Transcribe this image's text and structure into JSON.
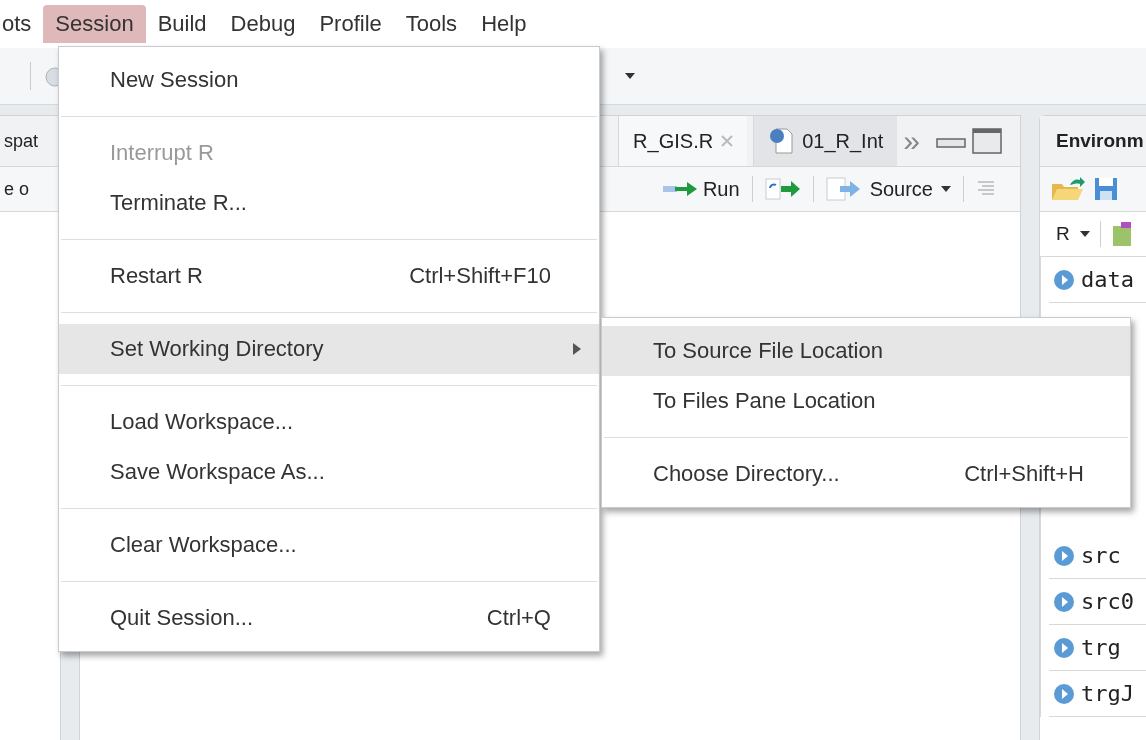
{
  "menubar": [
    {
      "label": "ots",
      "selected": false
    },
    {
      "label": "Session",
      "selected": true
    },
    {
      "label": "Build",
      "selected": false
    },
    {
      "label": "Debug",
      "selected": false
    },
    {
      "label": "Profile",
      "selected": false
    },
    {
      "label": "Tools",
      "selected": false
    },
    {
      "label": "Help",
      "selected": false
    }
  ],
  "left_pane": {
    "tab": "spat",
    "toolbar_text": "e o"
  },
  "editor": {
    "tabs": [
      {
        "label": "R_GIS.R",
        "selected": true,
        "closable": true
      },
      {
        "label": "01_R_Int",
        "selected": false,
        "closable": false
      }
    ],
    "overflow": "»",
    "run": "Run",
    "source": "Source"
  },
  "environment": {
    "title": "Environm",
    "language": "R",
    "rows_top": [
      "data"
    ],
    "rows_bottom": [
      "src",
      "src0",
      "trg",
      "trgJ"
    ]
  },
  "session_menu": {
    "items": [
      {
        "kind": "item",
        "label": "New Session",
        "disabled": false,
        "selected": false,
        "submenu": false
      },
      {
        "kind": "separator"
      },
      {
        "kind": "item",
        "label": "Interrupt R",
        "disabled": true,
        "selected": false,
        "submenu": false
      },
      {
        "kind": "item",
        "label": "Terminate R...",
        "disabled": false,
        "selected": false,
        "submenu": false
      },
      {
        "kind": "separator"
      },
      {
        "kind": "item",
        "label": "Restart R",
        "shortcut": "Ctrl+Shift+F10",
        "disabled": false,
        "selected": false,
        "submenu": false
      },
      {
        "kind": "separator"
      },
      {
        "kind": "item",
        "label": "Set Working Directory",
        "disabled": false,
        "selected": true,
        "submenu": true
      },
      {
        "kind": "separator"
      },
      {
        "kind": "item",
        "label": "Load Workspace...",
        "disabled": false,
        "selected": false,
        "submenu": false
      },
      {
        "kind": "item",
        "label": "Save Workspace As...",
        "disabled": false,
        "selected": false,
        "submenu": false
      },
      {
        "kind": "separator"
      },
      {
        "kind": "item",
        "label": "Clear Workspace...",
        "disabled": false,
        "selected": false,
        "submenu": false
      },
      {
        "kind": "separator"
      },
      {
        "kind": "item",
        "label": "Quit Session...",
        "shortcut": "Ctrl+Q",
        "disabled": false,
        "selected": false,
        "submenu": false
      }
    ]
  },
  "submenu": {
    "items": [
      {
        "kind": "item",
        "label": "To Source File Location",
        "disabled": false,
        "selected": true
      },
      {
        "kind": "item",
        "label": "To Files Pane Location",
        "disabled": false,
        "selected": false
      },
      {
        "kind": "separator"
      },
      {
        "kind": "item",
        "label": "Choose Directory...",
        "shortcut": "Ctrl+Shift+H",
        "disabled": false,
        "selected": false
      }
    ]
  }
}
